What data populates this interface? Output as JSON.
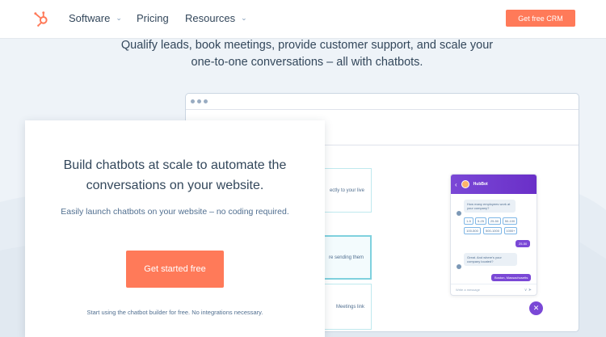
{
  "nav": {
    "items": [
      {
        "label": "Software",
        "has_dropdown": true
      },
      {
        "label": "Pricing",
        "has_dropdown": false
      },
      {
        "label": "Resources",
        "has_dropdown": true
      }
    ],
    "cta_label": "Get free CRM"
  },
  "hero": {
    "subtitle": "Qualify leads, book meetings, provide customer support, and scale your one-to-one conversations – all with chatbots."
  },
  "mockup": {
    "tasks": [
      {
        "label": "ectly to your live"
      },
      {
        "label": "re sending them"
      },
      {
        "label": "Meetings link"
      }
    ],
    "chat": {
      "title": "HubBot",
      "question1": "How many employees work at your company?",
      "options": [
        "1-5",
        "5-25",
        "25-50",
        "50-100",
        "100-500",
        "500-1000",
        "1000+"
      ],
      "answer1": "25-50",
      "question2": "Great. And where's your company located?",
      "answer2": "Boston, Massachusetts",
      "input_placeholder": "Write a message",
      "close_icon": "close-icon"
    }
  },
  "card": {
    "title": "Build chatbots at scale to automate the conversations on your website.",
    "description": "Easily launch chatbots on your website – no coding required.",
    "button_label": "Get started free",
    "note": "Start using the chatbot builder for free. No integrations necessary."
  },
  "colors": {
    "accent": "#ff7a59",
    "chat_purple": "#7a48d6",
    "text": "#33475b",
    "background": "#eef3f8"
  }
}
